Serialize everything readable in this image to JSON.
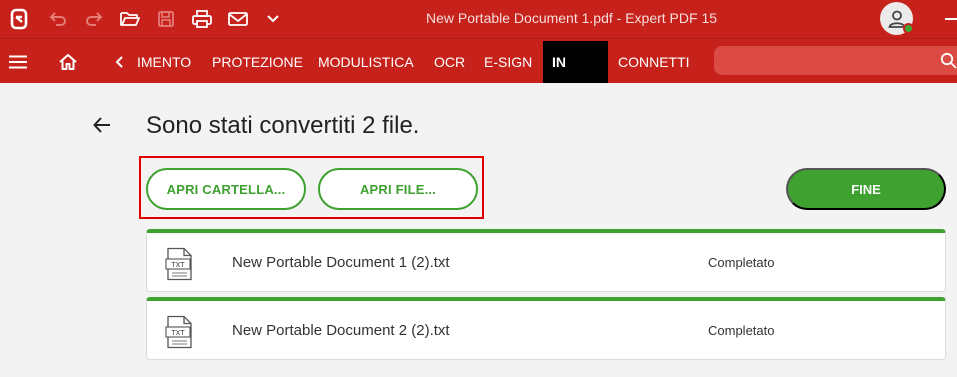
{
  "window": {
    "title": "New Portable Document 1.pdf  -  Expert PDF 15"
  },
  "menu": {
    "tabs": [
      "IMENTO",
      "PROTEZIONE",
      "MODULISTICA",
      "OCR",
      "E-SIGN",
      "IN",
      "CONNETTI"
    ],
    "active_tab": "IN"
  },
  "main": {
    "heading": "Sono stati convertiti 2 file.",
    "open_folder_label": "APRI CARTELLA...",
    "open_file_label": "APRI FILE...",
    "done_label": "FINE"
  },
  "files": [
    {
      "icon_text": "TXT",
      "name": "New Portable Document 1 (2).txt",
      "status": "Completato"
    },
    {
      "icon_text": "TXT",
      "name": "New Portable Document 2 (2).txt",
      "status": "Completato"
    }
  ],
  "colors": {
    "brand_red": "#c6221b",
    "accent_green": "#3ea130",
    "highlight_red": "#e00000"
  }
}
